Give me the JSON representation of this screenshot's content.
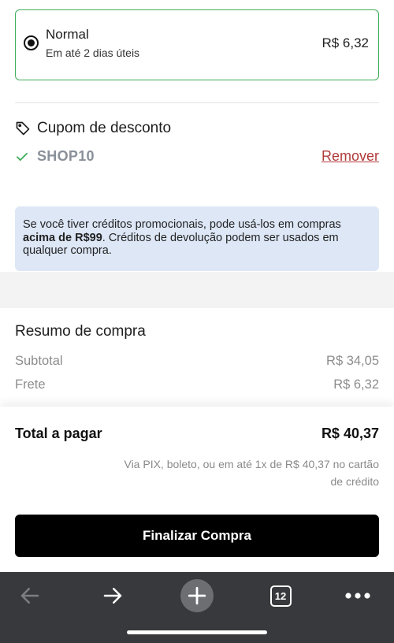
{
  "shipping": {
    "name": "Normal",
    "eta": "Em até 2 dias úteis",
    "price": "R$ 6,32"
  },
  "coupon": {
    "title": "Cupom de desconto",
    "code": "SHOP10",
    "remove_label": "Remover"
  },
  "info": {
    "text_before": "Se você tiver créditos promocionais, pode usá-los em compras ",
    "text_bold": "acima de R$99",
    "text_after": ". Créditos de devolução podem ser usados em qualquer compra."
  },
  "summary": {
    "title": "Resumo de compra",
    "subtotal_label": "Subtotal",
    "subtotal_value": "R$ 34,05",
    "shipping_label": "Frete",
    "shipping_value": "R$ 6,32"
  },
  "total": {
    "label": "Total a pagar",
    "value": "R$ 40,37",
    "payment_note": "Via PIX, boleto, ou em até 1x de R$ 40,37 no cartão de crédito"
  },
  "checkout": {
    "button_label": "Finalizar Compra"
  },
  "browser": {
    "tab_count": "12",
    "icons": [
      "back-arrow-icon",
      "forward-arrow-icon",
      "new-tab-plus-icon",
      "tab-switcher-icon",
      "more-options-icon"
    ]
  },
  "colors": {
    "selected_border": "#3fae5b",
    "remove_link": "#b23a3a",
    "info_background": "#dde7f6",
    "checkout_button": "#000000",
    "browser_bar": "#37393c"
  }
}
